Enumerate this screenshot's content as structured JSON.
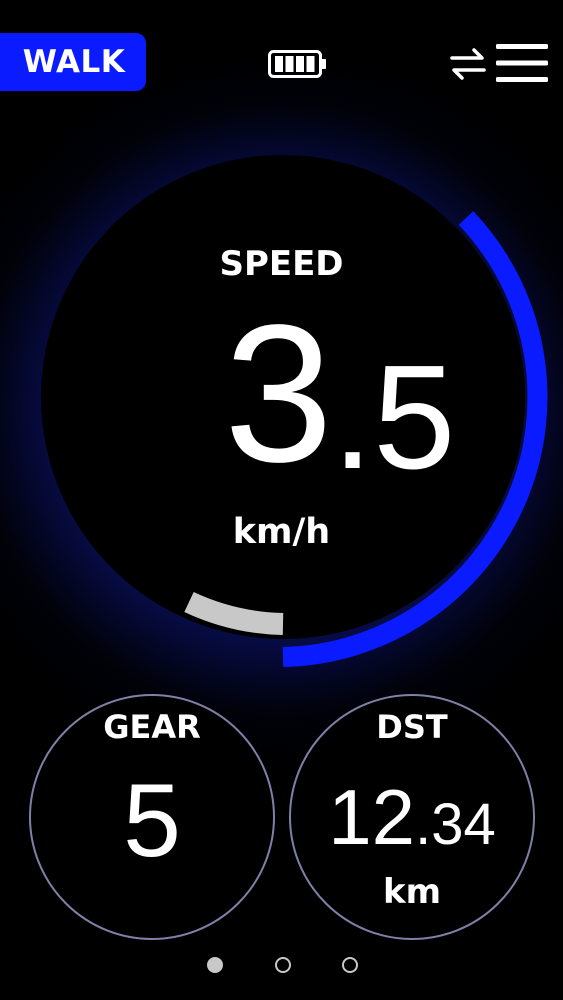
{
  "header": {
    "mode_label": "WALK",
    "battery_icon": "battery-icon",
    "battery_level_bars": 4,
    "battery_level_max": 4,
    "swap_icon": "swap-arrows-icon",
    "menu_icon": "hamburger-menu-icon"
  },
  "speed": {
    "label": "SPEED",
    "value_int": "3",
    "value_dec": ".5",
    "unit": "km/h",
    "gauge_fraction": 0.35,
    "gauge_color": "#0a1bff",
    "assist_marker_color": "#c8c8c8"
  },
  "gear": {
    "label": "GEAR",
    "value": "5"
  },
  "distance": {
    "label": "DST",
    "value_int": "12",
    "value_sep": ".",
    "value_frac": "34",
    "unit": "km"
  },
  "pagination": {
    "pages": 3,
    "current": 1
  },
  "colors": {
    "accent": "#0a1bff",
    "background": "#000000",
    "ring_outline": "#7e80a8"
  }
}
